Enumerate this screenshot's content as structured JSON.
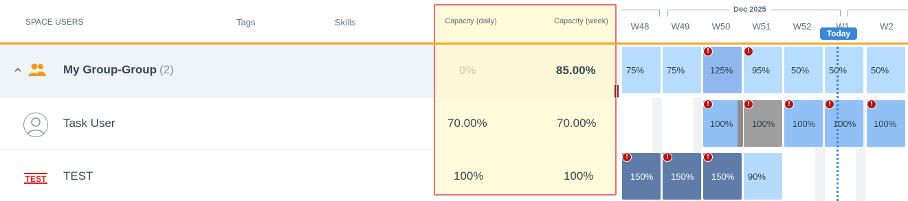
{
  "header": {
    "space_users": "SPACE USERS",
    "tags": "Tags",
    "skills": "Skills",
    "capacity_daily": "Capacity (daily)",
    "capacity_week": "Capacity (week)"
  },
  "timeline": {
    "month": "Dec 2025",
    "weeks": [
      "W48",
      "W49",
      "W50",
      "W51",
      "W52",
      "W1",
      "W2"
    ],
    "today": "Today"
  },
  "rows": {
    "group": {
      "name": "My Group-Group",
      "count": "(2)",
      "capacity_daily": "0%",
      "capacity_week": "85.00%",
      "cells": [
        "75%",
        "75%",
        "125%",
        "95%",
        "50%",
        "50%",
        "50%"
      ]
    },
    "task_user": {
      "name": "Task User",
      "capacity_daily": "70.00%",
      "capacity_week": "70.00%",
      "cells": [
        "100%",
        "100%",
        "100%",
        "100%",
        "100%"
      ]
    },
    "test": {
      "name": "TEST",
      "logo_text": "TEST",
      "capacity_daily": "100%",
      "capacity_week": "100%",
      "cells": [
        "150%",
        "150%",
        "150%",
        "90%"
      ]
    }
  },
  "icons": {
    "alert": "!",
    "chevron": "^"
  },
  "colors": {
    "accent_orange": "#f5a623",
    "highlight_border": "#ec6f6f",
    "today_blue": "#3a86d6",
    "alert_red": "#b01414"
  }
}
